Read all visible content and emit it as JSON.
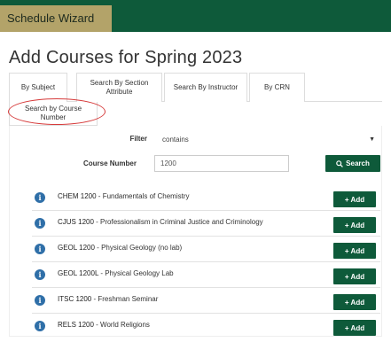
{
  "app": {
    "wizard_label": "Schedule Wizard"
  },
  "page": {
    "title": "Add Courses for Spring 2023"
  },
  "tabs": [
    {
      "label": "By Subject"
    },
    {
      "label": "Search By Section Attribute"
    },
    {
      "label": "Search By Instructor"
    },
    {
      "label": "By CRN"
    },
    {
      "label": "Search by Course Number"
    }
  ],
  "form": {
    "filter_label": "Filter",
    "filter_value": "contains",
    "course_number_label": "Course Number",
    "course_number_value": "1200",
    "search_label": "Search"
  },
  "results": [
    {
      "code": "CHEM 1200",
      "name": "Fundamentals of Chemistry"
    },
    {
      "code": "CJUS 1200",
      "name": "Professionalism in Criminal Justice and Criminology"
    },
    {
      "code": "GEOL 1200",
      "name": "Physical Geology (no lab)"
    },
    {
      "code": "GEOL 1200L",
      "name": "Physical Geology Lab"
    },
    {
      "code": "ITSC 1200",
      "name": "Freshman Seminar"
    },
    {
      "code": "RELS 1200",
      "name": "World Religions"
    }
  ],
  "add_label": "Add",
  "colors": {
    "brand_green": "#0e5a3a",
    "gold": "#b3a369",
    "highlight": "#d63b3b",
    "info_blue": "#2f6fa8"
  }
}
